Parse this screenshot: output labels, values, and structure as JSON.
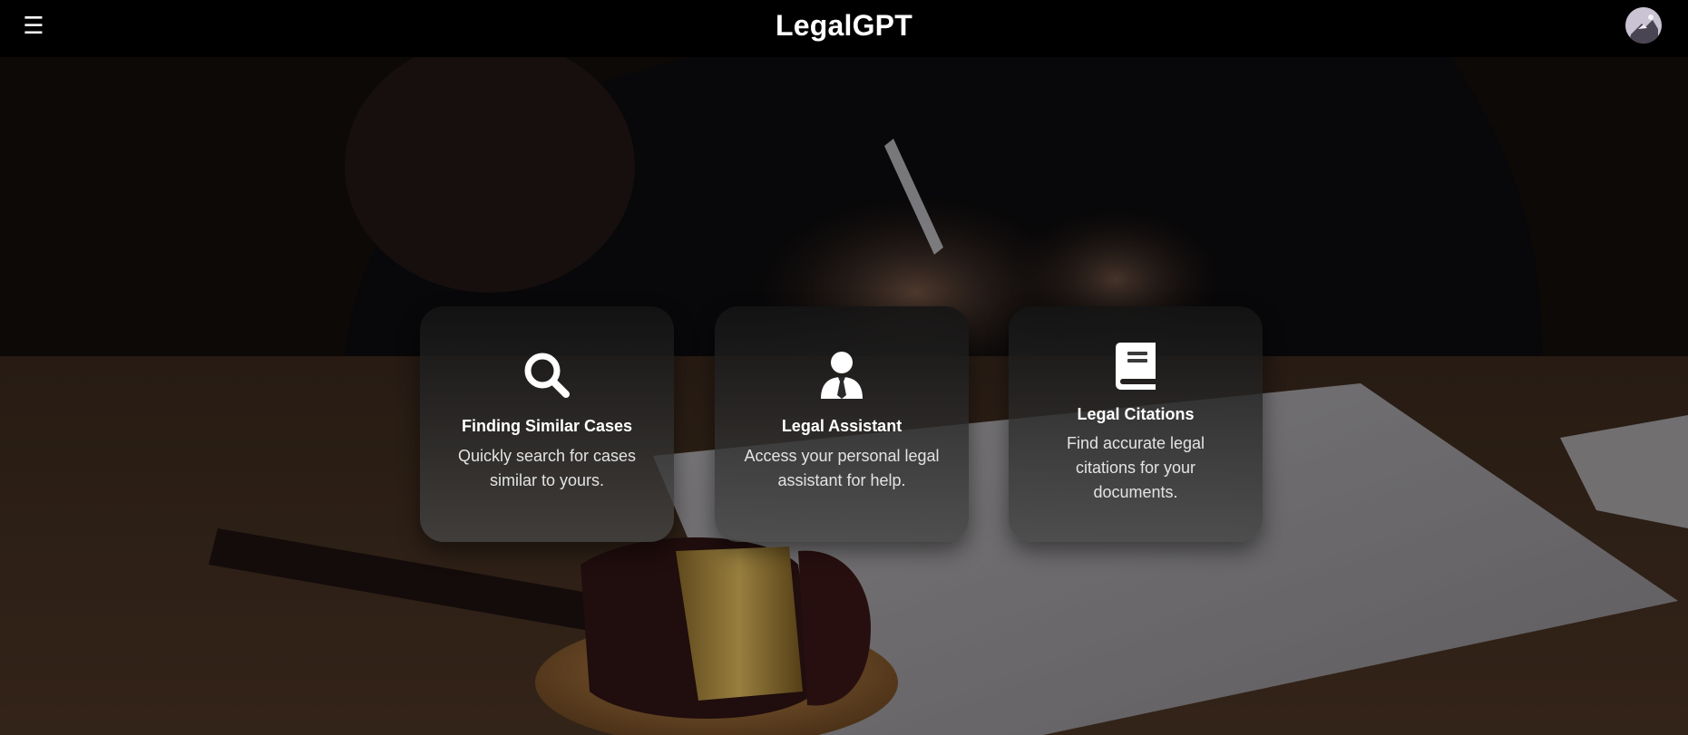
{
  "header": {
    "menu_icon": "hamburger-icon",
    "title": "LegalGPT",
    "avatar_icon": "user-avatar"
  },
  "cards": [
    {
      "icon": "search-icon",
      "title": "Finding Similar Cases",
      "description": "Quickly search for cases similar to yours."
    },
    {
      "icon": "user-tie-icon",
      "title": "Legal Assistant",
      "description": "Access your personal legal assistant for help."
    },
    {
      "icon": "book-icon",
      "title": "Legal Citations",
      "description": "Find accurate legal citations for your documents."
    }
  ],
  "colors": {
    "topbar": "#000000",
    "text": "#ffffff",
    "card_bg": "#2a2a2a"
  }
}
